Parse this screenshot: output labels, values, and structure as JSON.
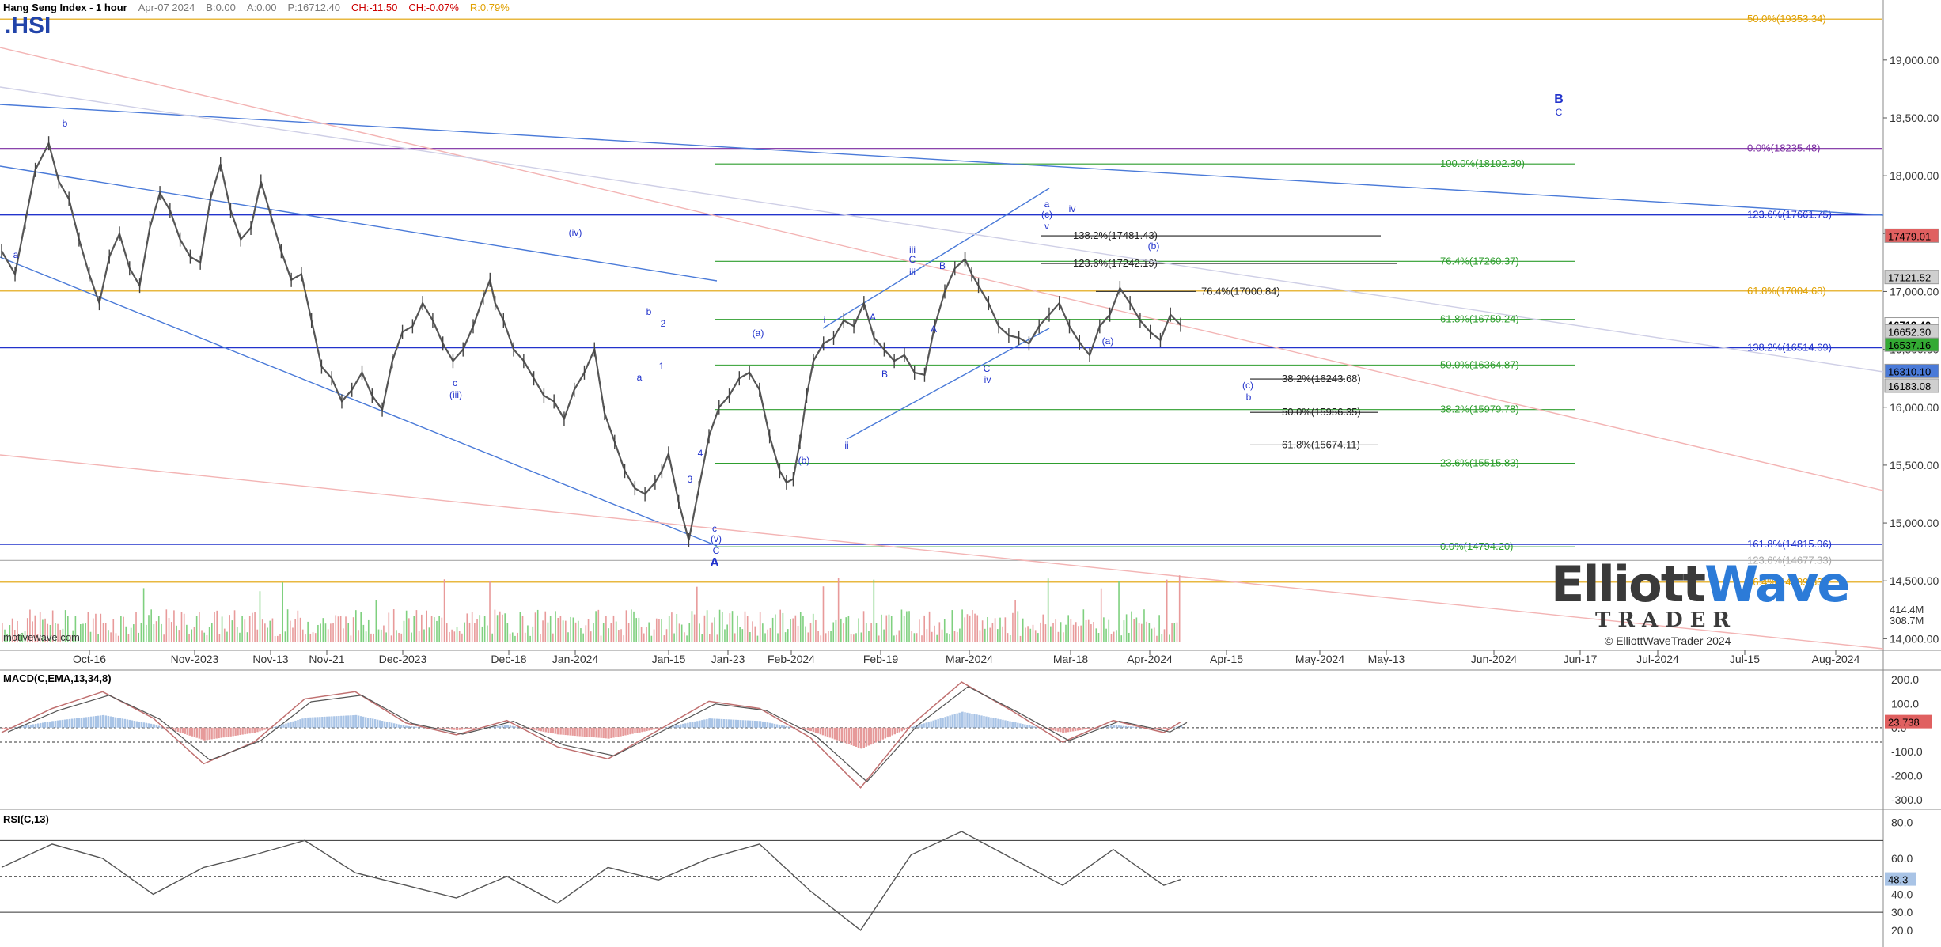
{
  "header": {
    "title": "Hang Seng Index - 1 hour",
    "date": "Apr-07 2024",
    "b": "B:0.00",
    "a": "A:0.00",
    "p": "P:16712.40",
    "ch": "CH:-11.50",
    "chp": "CH:-0.07%",
    "r": "R:0.79%"
  },
  "symbol": ".HSI",
  "watermark": "motivewave.com",
  "logo": {
    "word1": "Elliott",
    "word2": "Wave",
    "sub": "TRADER",
    "copyright": "© ElliottWaveTrader 2024"
  },
  "colors": {
    "price": "#555555",
    "fib_green": "#2e9e2e",
    "fib_blue": "#2233cc",
    "fib_orange": "#e0a000",
    "fib_purple": "#7a2aa0",
    "channel": "#4a7ad8",
    "macd_up": "#a9c4e6",
    "macd_down": "#e69a9a",
    "rsi": "#555555"
  },
  "chart_data": [
    {
      "type": "line",
      "title": "Hang Seng Index - 1 hour",
      "x_tick_labels": [
        "Oct-16",
        "Nov-2023",
        "Nov-13",
        "Nov-21",
        "Dec-2023",
        "Dec-18",
        "Jan-2024",
        "Jan-15",
        "Jan-23",
        "Feb-2024",
        "Feb-19",
        "Mar-2024",
        "Mar-18",
        "Apr-2024",
        "Apr-15",
        "May-2024",
        "May-13",
        "Jun-2024",
        "Jun-17",
        "Jul-2024",
        "Jul-15",
        "Aug-2024"
      ],
      "y_ticks": [
        14000,
        14500,
        15000,
        15500,
        16000,
        16500,
        17000,
        17500,
        18000,
        18500,
        19000
      ],
      "ylim": [
        13900,
        19450
      ],
      "series": [
        {
          "name": "",
          "x": [
            0,
            8,
            14,
            20,
            28,
            34,
            40,
            46,
            52,
            58,
            64,
            70,
            76,
            82,
            88,
            94,
            100,
            106,
            112,
            118,
            124,
            130,
            136,
            142,
            148,
            154,
            160,
            166,
            172,
            178,
            184,
            190,
            196,
            202,
            208,
            214,
            220,
            226,
            232,
            238,
            244,
            250,
            256,
            262,
            268,
            274,
            280,
            286,
            290,
            293,
            298,
            304,
            310,
            316,
            322,
            328,
            334,
            340,
            346,
            352,
            358,
            364,
            370,
            376,
            382,
            388,
            392,
            396,
            402,
            408,
            414,
            420,
            426,
            432,
            438,
            444,
            450,
            456,
            462,
            466,
            470,
            474,
            478,
            482,
            488,
            494,
            500,
            506,
            512,
            518,
            524,
            530,
            536,
            542,
            548,
            554,
            560,
            566,
            572
          ],
          "y": [
            17350,
            17150,
            17600,
            18050,
            18280,
            17950,
            17800,
            17450,
            17150,
            16900,
            17300,
            17500,
            17200,
            17050,
            17550,
            17850,
            17700,
            17450,
            17300,
            17250,
            17800,
            18100,
            17700,
            17450,
            17550,
            17950,
            17650,
            17350,
            17100,
            17150,
            16750,
            16350,
            16250,
            16050,
            16150,
            16300,
            16100,
            15980,
            16400,
            16650,
            16700,
            16900,
            16750,
            16550,
            16400,
            16500,
            16700,
            16950,
            17100,
            16900,
            16750,
            16500,
            16400,
            16250,
            16100,
            16050,
            15900,
            16150,
            16300,
            16500,
            15950,
            15700,
            15450,
            15300,
            15250,
            15350,
            15450,
            15600,
            15180,
            14850,
            15300,
            15750,
            16000,
            16100,
            16250,
            16300,
            16150,
            15750,
            15450,
            15350,
            15380,
            15700,
            16100,
            16400,
            16550,
            16600,
            16750,
            16700,
            16900,
            16600,
            16500,
            16400,
            16450,
            16300,
            16280,
            16700,
            17000,
            17200,
            17280
          ]
        },
        {
          "name": "",
          "x": [
            572,
            576,
            580,
            586,
            592,
            598,
            604,
            610,
            616,
            622,
            628,
            634,
            640,
            646,
            652,
            658,
            664,
            670,
            676,
            682,
            688,
            694,
            700
          ],
          "y": [
            17280,
            17150,
            17050,
            16900,
            16700,
            16620,
            16600,
            16550,
            16700,
            16800,
            16900,
            16700,
            16560,
            16450,
            16700,
            16800,
            17030,
            16900,
            16750,
            16650,
            16580,
            16800,
            16712
          ]
        }
      ]
    },
    {
      "type": "bar",
      "title": "",
      "series": [
        {
          "name": "",
          "values": [
            414.4,
            308.7
          ]
        }
      ],
      "y_tick_labels": [
        "414.4M",
        "308.7M"
      ]
    },
    {
      "type": "line",
      "title": "MACD(C,EMA,13,34,8)",
      "y_ticks": [
        200,
        100,
        0,
        -100,
        -200,
        -300
      ],
      "ylim": [
        -330,
        230
      ],
      "current_value": 23.738,
      "series": [
        {
          "name": "",
          "x": [
            0,
            30,
            60,
            90,
            120,
            150,
            180,
            210,
            240,
            270,
            300,
            330,
            360,
            390,
            420,
            450,
            480,
            510,
            540,
            570,
            600,
            630,
            660,
            690,
            700
          ],
          "y": [
            -20,
            80,
            150,
            40,
            -150,
            -60,
            120,
            150,
            20,
            -30,
            30,
            -80,
            -130,
            -10,
            110,
            80,
            -40,
            -250,
            10,
            190,
            70,
            -60,
            30,
            -20,
            23.7
          ]
        }
      ]
    },
    {
      "type": "line",
      "title": "RSI(C,13)",
      "y_ticks": [
        80,
        60,
        40,
        30,
        20
      ],
      "ylim": [
        12,
        86
      ],
      "current_value": 48.3,
      "series": [
        {
          "name": "",
          "x": [
            0,
            30,
            60,
            90,
            120,
            150,
            180,
            210,
            240,
            270,
            300,
            330,
            360,
            390,
            420,
            450,
            480,
            510,
            540,
            570,
            600,
            630,
            660,
            690,
            700
          ],
          "y": [
            55,
            68,
            60,
            40,
            55,
            62,
            70,
            52,
            45,
            38,
            50,
            35,
            55,
            48,
            60,
            68,
            42,
            20,
            62,
            75,
            60,
            45,
            65,
            45,
            48.3
          ]
        }
      ]
    }
  ],
  "fib_levels": {
    "green": [
      {
        "label": "100.0%(18102.30)",
        "value": 18102.3
      },
      {
        "label": "76.4%(17260.37)",
        "value": 17260.37
      },
      {
        "label": "61.8%(16759.24)",
        "value": 16759.24
      },
      {
        "label": "50.0%(16364.87)",
        "value": 16364.87
      },
      {
        "label": "38.2%(15979.78)",
        "value": 15979.78
      },
      {
        "label": "23.6%(15515.83)",
        "value": 15515.83
      },
      {
        "label": "0.0%(14794.20)",
        "value": 14794.2
      }
    ],
    "blue": [
      {
        "label": "123.6%(17661.75)",
        "value": 17661.75
      },
      {
        "label": "138.2%(16514.69)",
        "value": 16514.69
      },
      {
        "label": "161.8%(14815.96)",
        "value": 14815.96
      }
    ],
    "orange": [
      {
        "label": "50.0%(19353.34)",
        "value": 19353.34
      },
      {
        "label": "61.8%(17004.68)",
        "value": 17004.68
      },
      {
        "label": "76.4%(14489.33)",
        "value": 14489.33
      }
    ],
    "purple": [
      {
        "label": "0.0%(18235.48)",
        "value": 18235.48
      }
    ],
    "grey": [
      {
        "label": "123.6%(14677.33)",
        "value": 14677.33
      }
    ],
    "black": [
      {
        "label": "138.2%(17481.43)",
        "value": 17481.43
      },
      {
        "label": "123.6%(17242.19)",
        "value": 17242.19
      },
      {
        "label": "76.4%(17000.84)",
        "value": 17000.84
      },
      {
        "label": "38.2%(16243.68)",
        "value": 16243.68
      },
      {
        "label": "50.0%(15956.35)",
        "value": 15956.35
      },
      {
        "label": "61.8%(15674.11)",
        "value": 15674.11
      }
    ]
  },
  "price_tags": [
    {
      "label": "17479.01",
      "value": 17479.01,
      "color": "#e06060"
    },
    {
      "label": "17121.52",
      "value": 17121.52,
      "color": "#cfcfcf"
    },
    {
      "label": "16712.40",
      "value": 16712.4,
      "color": "#ffffff"
    },
    {
      "label": "16652.30",
      "value": 16652.3,
      "color": "#cfcfcf"
    },
    {
      "label": "16537.16",
      "value": 16537.16,
      "color": "#33aa33"
    },
    {
      "label": "16310.10",
      "value": 16310.1,
      "color": "#4a7ad8"
    },
    {
      "label": "16183.08",
      "value": 16183.08,
      "color": "#cfcfcf"
    }
  ],
  "wave_labels": [
    "a",
    "b",
    "c",
    "(iii)",
    "(iv)",
    "b",
    "a",
    "1",
    "2",
    "3",
    "4",
    "c",
    "(v)",
    "C",
    "A",
    "iii",
    "(a)",
    "(b)",
    "i",
    "ii",
    "A",
    "B",
    "C",
    "iii",
    "A",
    "B",
    "C",
    "iv",
    "v",
    "(c)",
    "a",
    "iv",
    "(a)",
    "(b)",
    "(c)",
    "b",
    "B",
    "C"
  ]
}
